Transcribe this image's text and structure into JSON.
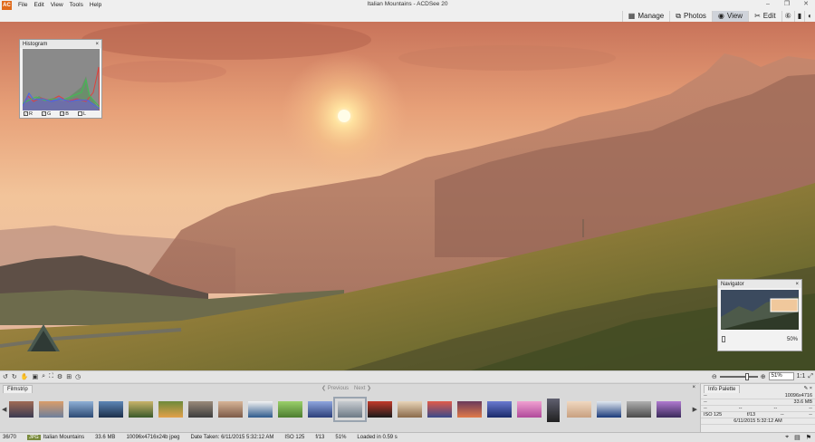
{
  "app": {
    "logo": "AC",
    "title": "Italian Mountains - ACDSee 20",
    "menu": [
      "File",
      "Edit",
      "View",
      "Tools",
      "Help"
    ]
  },
  "modes": [
    {
      "label": "Manage",
      "icon": "grid-icon",
      "glyph": "▦",
      "active": false
    },
    {
      "label": "Photos",
      "icon": "photos-icon",
      "glyph": "⧉",
      "active": false
    },
    {
      "label": "View",
      "icon": "eye-icon",
      "glyph": "◉",
      "active": true
    },
    {
      "label": "Edit",
      "icon": "tools-icon",
      "glyph": "✂",
      "active": false
    }
  ],
  "mode_extra_icons": [
    {
      "name": "365-icon",
      "glyph": "⑥"
    },
    {
      "name": "dashboard-icon",
      "glyph": "▮"
    },
    {
      "name": "sync-icon",
      "glyph": "◐"
    }
  ],
  "histogram": {
    "title": "Histogram",
    "close": "×",
    "channels": [
      "R",
      "G",
      "B",
      "L"
    ],
    "colors": {
      "red": "#e0413a",
      "green": "#3fbf52",
      "blue": "#4a64e8",
      "bg": "#8a8a8a"
    }
  },
  "navigator": {
    "title": "Navigator",
    "close": "×",
    "zoom": "50%"
  },
  "toolbar": {
    "zoom_value": "51%",
    "ratio": "1:1"
  },
  "filmstrip": {
    "title": "Filmstrip",
    "close": "×",
    "previous": "Previous",
    "next": "Next",
    "selected_index": 11
  },
  "info_palette": {
    "title": "Info Palette",
    "dimensions": "10096x4716",
    "size": "33.6 MB",
    "iso": "ISO 125",
    "aperture": "f/13",
    "date": "6/11/2015 5:32:12 AM",
    "dashes": "--"
  },
  "status": {
    "position": "36/70",
    "badge": "JPG",
    "name": "Italian Mountains",
    "filesize": "33.6 MB",
    "format": "10096x4716x24b jpeg",
    "date_taken": "Date Taken: 6/11/2015 5:32:12 AM",
    "iso": "ISO 125",
    "aperture": "f/13",
    "zoom": "51%",
    "loaded": "Loaded in 0.59 s"
  }
}
